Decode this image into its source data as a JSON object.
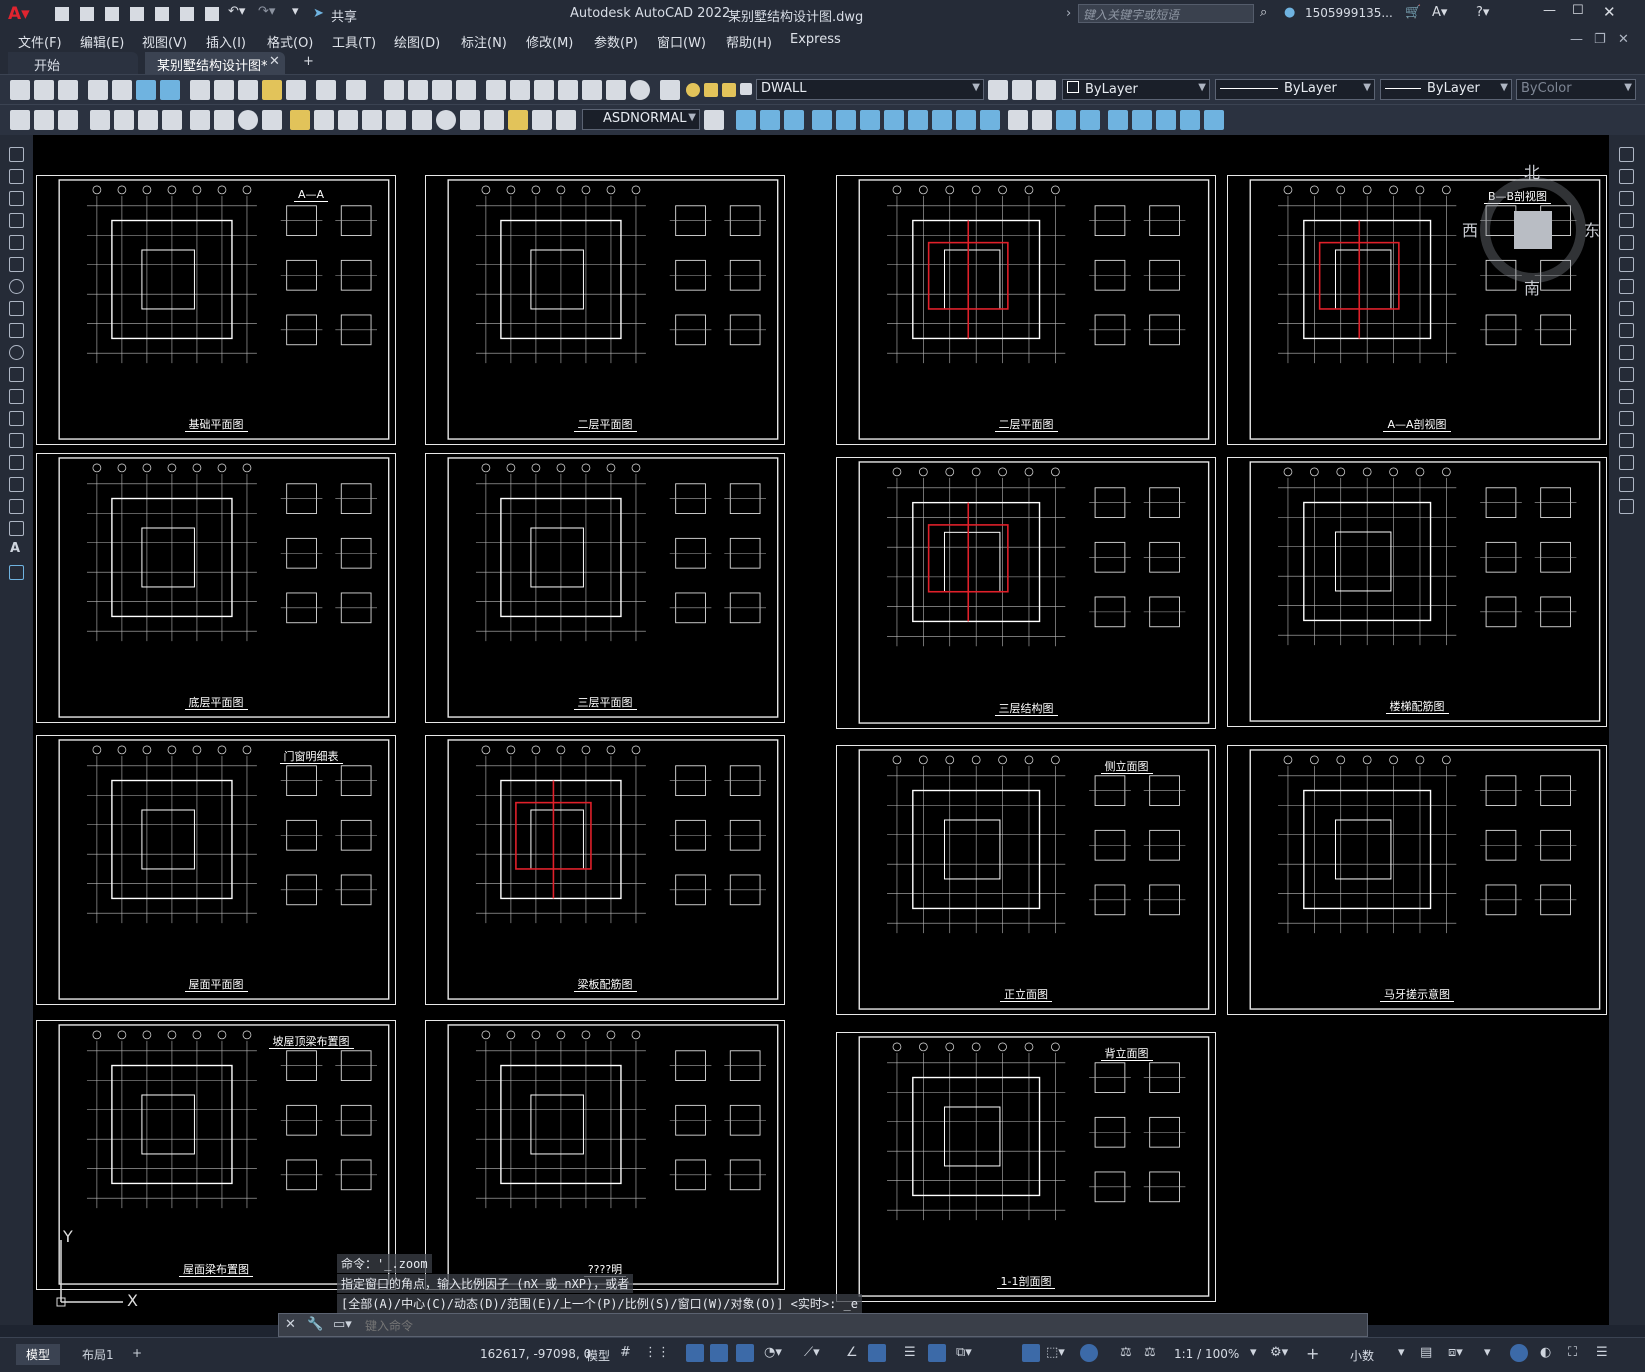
{
  "app": {
    "title": "Autodesk AutoCAD 2022",
    "file": "某别墅结构设计图.dwg",
    "search_placeholder": "键入关键字或短语",
    "user": "1505999135...",
    "share": "共享"
  },
  "menu": [
    "文件(F)",
    "编辑(E)",
    "视图(V)",
    "插入(I)",
    "格式(O)",
    "工具(T)",
    "绘图(D)",
    "标注(N)",
    "修改(M)",
    "参数(P)",
    "窗口(W)",
    "帮助(H)",
    "Express"
  ],
  "tabs": {
    "start": "开始",
    "active": "某别墅结构设计图*",
    "add": "+"
  },
  "toolbar": {
    "layer": "DWALL",
    "color": "ByLayer",
    "linetype": "ByLayer",
    "lineweight": "ByLayer",
    "plotstyle": "ByColor",
    "dimstyle": "ASDNORMAL"
  },
  "viewcube": {
    "north": "北",
    "south": "南",
    "east": "东",
    "west": "西"
  },
  "sheets": [
    {
      "title": "基础平面图",
      "sub": "A—A"
    },
    {
      "title": "二层平面图"
    },
    {
      "title": "二层平面图",
      "red": true
    },
    {
      "title": "A—A剖视图",
      "sub": "B—B剖视图",
      "red": true
    },
    {
      "title": "底层平面图"
    },
    {
      "title": "三层平面图"
    },
    {
      "title": "三层结构图",
      "red": true
    },
    {
      "title": "楼梯配筋图"
    },
    {
      "title": "屋面平面图",
      "sub": "门窗明细表"
    },
    {
      "title": "梁板配筋图",
      "red": true
    },
    {
      "title": "正立面图",
      "sub": "侧立面图"
    },
    {
      "title": "马牙搓示意图"
    },
    {
      "title": "屋面梁布置图",
      "sub": "坡屋顶梁布置图"
    },
    {
      "title": "????明"
    },
    {
      "title": "1-1剖面图",
      "sub": "背立面图"
    }
  ],
  "command": {
    "line1": "命令：'_.zoom",
    "line2": "指定窗口的角点，输入比例因子 (nX 或 nXP)，或者",
    "line3": "[全部(A)/中心(C)/动态(D)/范围(E)/上一个(P)/比例(S)/窗口(W)/对象(O)] <实时>: _e",
    "input_placeholder": "键入命令"
  },
  "status": {
    "model_tab": "模型",
    "layout_tab": "布局1",
    "add": "+",
    "coords": "162617, -97098, 0",
    "mode": "模型",
    "scale": "1:1 / 100%",
    "units": "小数"
  }
}
